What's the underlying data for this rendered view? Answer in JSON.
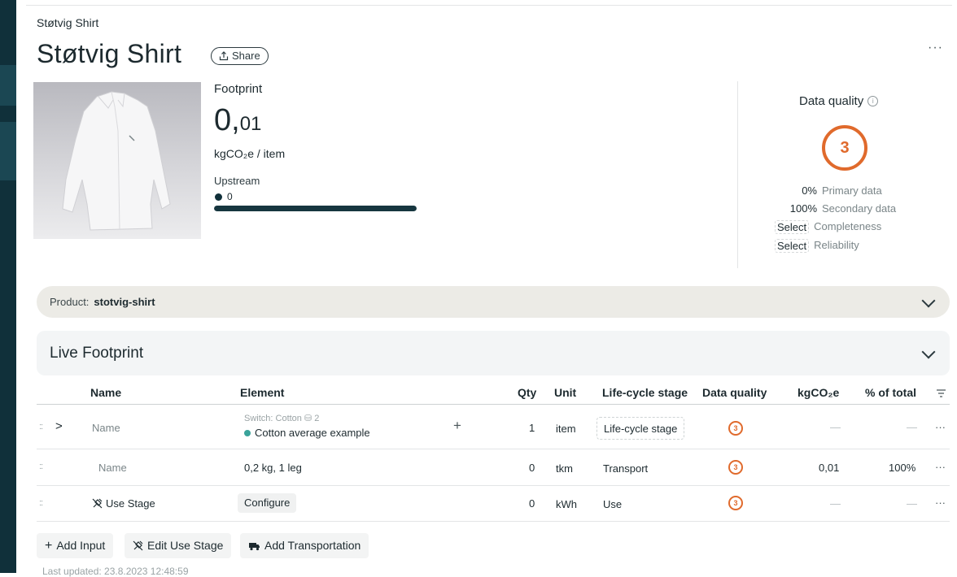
{
  "breadcrumb": "Støtvig Shirt",
  "title": "Støtvig Shirt",
  "share_label": "Share",
  "more_label": "···",
  "footprint": {
    "label": "Footprint",
    "value_main": "0,",
    "value_small": "01",
    "unit": "kgCO₂e  /  item",
    "upstream_label": "Upstream",
    "upstream_value": "0",
    "upstream_fraction": 1.0
  },
  "data_quality": {
    "title": "Data quality",
    "info_icon": "info-icon",
    "score": "3",
    "rows": [
      {
        "key": "0%",
        "label": "Primary data"
      },
      {
        "key": "100%",
        "label": "Secondary data"
      },
      {
        "key": "Select",
        "label": "Completeness"
      },
      {
        "key": "Select",
        "label": "Reliability"
      }
    ]
  },
  "product_bar": {
    "label": "Product:",
    "value": "stotvig-shirt"
  },
  "live_footprint": {
    "title": "Live Footprint"
  },
  "table": {
    "headers": {
      "name": "Name",
      "element": "Element",
      "qty": "Qty",
      "unit": "Unit",
      "lcs": "Life-cycle stage",
      "dq": "Data quality",
      "kg": "kgCO₂e",
      "pct": "% of total"
    },
    "rows": [
      {
        "drag": "::",
        "expand": ">",
        "name": "Name",
        "switch": "Switch: Cotton ⛁ 2",
        "element": "Cotton average example",
        "plus": "+",
        "qty": "1",
        "unit": "item",
        "lcs": "Life-cycle stage",
        "dq": "3",
        "kg": "—",
        "pct": "—",
        "more": "···"
      },
      {
        "drag": "::",
        "name": "Name",
        "element": "0,2 kg, 1 leg",
        "qty": "0",
        "unit": "tkm",
        "lcs": "Transport",
        "dq": "3",
        "kg": "0,01",
        "pct": "100%",
        "more": "···"
      },
      {
        "drag": "::",
        "name": "Use Stage",
        "element": "Configure",
        "qty": "0",
        "unit": "kWh",
        "lcs": "Use",
        "dq": "3",
        "kg": "—",
        "pct": "—",
        "more": "···"
      }
    ]
  },
  "actions": {
    "add_input": "Add Input",
    "edit_use_stage": "Edit Use Stage",
    "add_transportation": "Add Transportation"
  },
  "last_updated": "Last updated: 23.8.2023 12:48:59",
  "colors": {
    "accent": "#e06a2c",
    "sidebar": "#10303a",
    "teal": "#3aa39a"
  }
}
